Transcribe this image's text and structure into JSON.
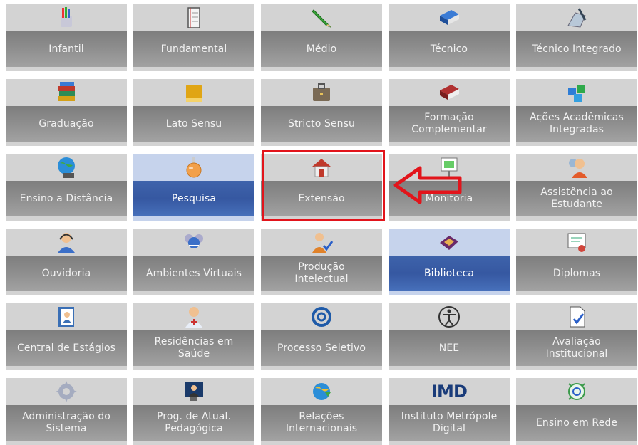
{
  "tiles": [
    {
      "label": "Infantil",
      "icon": "pencil-cup-icon"
    },
    {
      "label": "Fundamental",
      "icon": "notebook-icon"
    },
    {
      "label": "Médio",
      "icon": "green-pencil-icon"
    },
    {
      "label": "Técnico",
      "icon": "blue-book-icon"
    },
    {
      "label": "Técnico Integrado",
      "icon": "drawing-tool-icon"
    },
    {
      "label": "Graduação",
      "icon": "book-stack-icon"
    },
    {
      "label": "Lato Sensu",
      "icon": "yellow-book-icon"
    },
    {
      "label": "Stricto Sensu",
      "icon": "briefcase-icon"
    },
    {
      "label": "Formação\nComplementar",
      "icon": "red-book-icon"
    },
    {
      "label": "Ações Acadêmicas\nIntegradas",
      "icon": "puzzle-icon"
    },
    {
      "label": "Ensino a Distância",
      "icon": "globe-computer-icon"
    },
    {
      "label": "Pesquisa",
      "icon": "flask-icon",
      "active": true
    },
    {
      "label": "Extensão",
      "icon": "house-icon",
      "highlighted": true
    },
    {
      "label": "Monitoria",
      "icon": "presentation-board-icon"
    },
    {
      "label": "Assistência ao\nEstudante",
      "icon": "support-person-icon"
    },
    {
      "label": "Ouvidoria",
      "icon": "headset-person-icon"
    },
    {
      "label": "Ambientes Virtuais",
      "icon": "virtual-people-icon"
    },
    {
      "label": "Produção\nIntelectual",
      "icon": "person-check-icon"
    },
    {
      "label": "Biblioteca",
      "icon": "open-book-icon",
      "active": true
    },
    {
      "label": "Diplomas",
      "icon": "certificate-icon"
    },
    {
      "label": "Central de Estágios",
      "icon": "contact-book-icon"
    },
    {
      "label": "Residências em\nSaúde",
      "icon": "doctor-icon"
    },
    {
      "label": "Processo Seletivo",
      "icon": "at-sign-icon"
    },
    {
      "label": "NEE",
      "icon": "accessibility-icon"
    },
    {
      "label": "Avaliação\nInstitucional",
      "icon": "document-check-icon"
    },
    {
      "label": "Administração do\nSistema",
      "icon": "gear-icon"
    },
    {
      "label": "Prog. de Atual.\nPedagógica",
      "icon": "monitor-person-icon"
    },
    {
      "label": "Relações\nInternacionais",
      "icon": "globe-arrow-icon"
    },
    {
      "label": "Instituto Metrópole\nDigital",
      "icon": "imd-logo-icon",
      "icon_text": "IMD"
    },
    {
      "label": "Ensino em Rede",
      "icon": "network-at-icon"
    }
  ],
  "colors": {
    "tile_bg": "#d3d3d3",
    "label_bg": "#8d8d8d",
    "active_bg": "#c6d3ec",
    "active_label_bg": "#3658a1",
    "highlight": "#e2141b"
  }
}
